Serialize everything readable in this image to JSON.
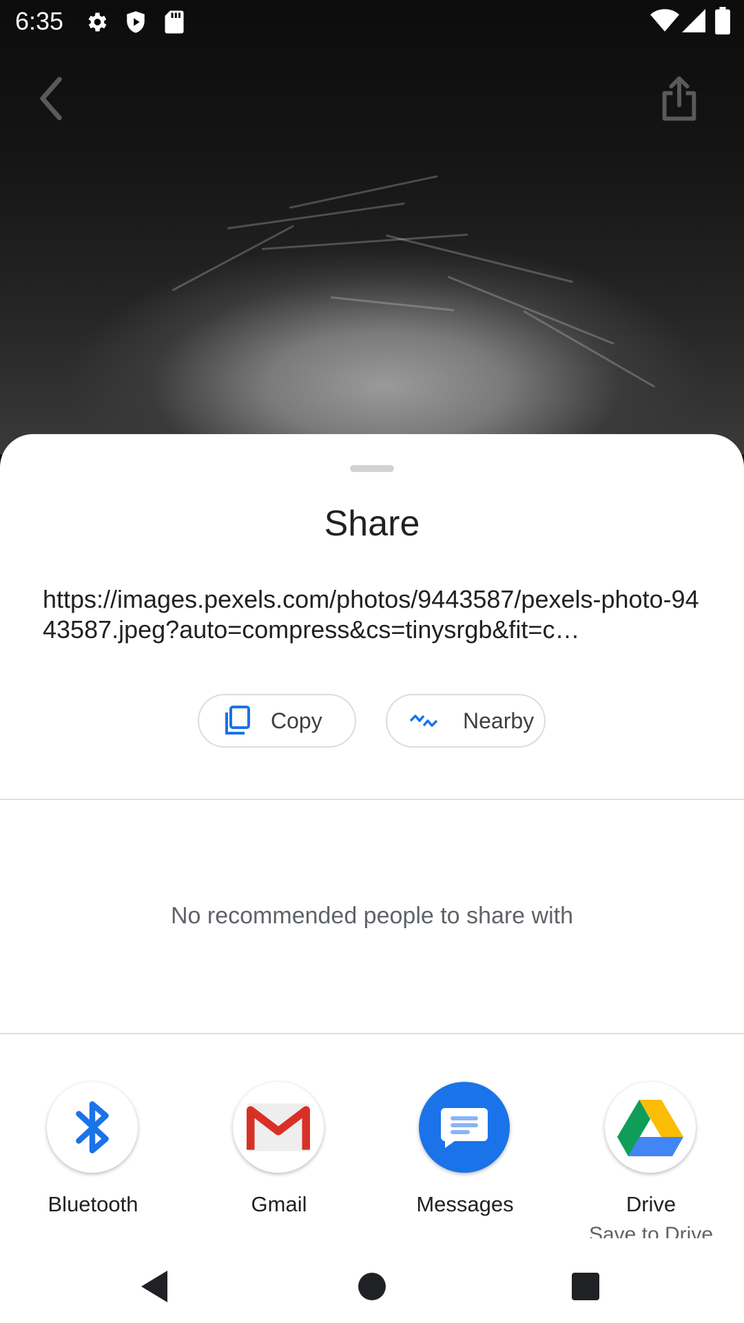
{
  "status_bar": {
    "time": "6:35",
    "left_icons": [
      "gear-icon",
      "shield-play-icon",
      "sd-card-icon"
    ],
    "right_icons": [
      "wifi-icon",
      "signal-icon",
      "battery-icon"
    ]
  },
  "top_bar": {
    "back_icon": "chevron-left-icon",
    "share_icon": "share-icon"
  },
  "share_sheet": {
    "title": "Share",
    "url": "https://images.pexels.com/photos/9443587/pexels-photo-9443587.jpeg?auto=compress&cs=tinysrgb&fit=c…",
    "actions": [
      {
        "label": "Copy",
        "icon": "copy-icon"
      },
      {
        "label": "Nearby",
        "icon": "nearby-icon"
      }
    ],
    "empty_people_message": "No recommended people to share with",
    "apps": [
      {
        "label": "Bluetooth",
        "sublabel": "",
        "icon": "bluetooth-icon"
      },
      {
        "label": "Gmail",
        "sublabel": "",
        "icon": "gmail-icon"
      },
      {
        "label": "Messages",
        "sublabel": "",
        "icon": "messages-icon"
      },
      {
        "label": "Drive",
        "sublabel": "Save to Drive",
        "icon": "drive-icon"
      }
    ]
  },
  "nav_bar": {
    "icons": [
      "back-triangle-icon",
      "home-circle-icon",
      "recents-square-icon"
    ]
  },
  "colors": {
    "accent_blue": "#1a73e8",
    "messages_blue": "#1a73e8",
    "sheet_background": "#ffffff",
    "text_primary": "#202124",
    "text_secondary": "#5f6368"
  }
}
